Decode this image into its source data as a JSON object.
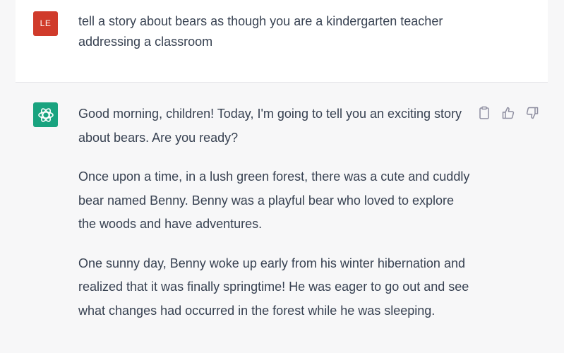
{
  "user_turn": {
    "avatar_initials": "LE",
    "avatar_color": "#d03b2b",
    "message": "tell a story about bears as though you are a kindergarten teacher addressing a classroom"
  },
  "assistant_turn": {
    "avatar_icon": "openai-logo-icon",
    "avatar_color": "#19a37f",
    "paragraphs": [
      "Good morning, children! Today, I'm going to tell you an exciting story about bears. Are you ready?",
      "Once upon a time, in a lush green forest, there was a cute and cuddly bear named Benny. Benny was a playful bear who loved to explore the woods and have adventures.",
      "One sunny day, Benny woke up early from his winter hibernation and realized that it was finally springtime! He was eager to go out and see what changes had occurred in the forest while he was sleeping."
    ],
    "actions": [
      "copy-icon",
      "thumbs-up-icon",
      "thumbs-down-icon"
    ]
  }
}
